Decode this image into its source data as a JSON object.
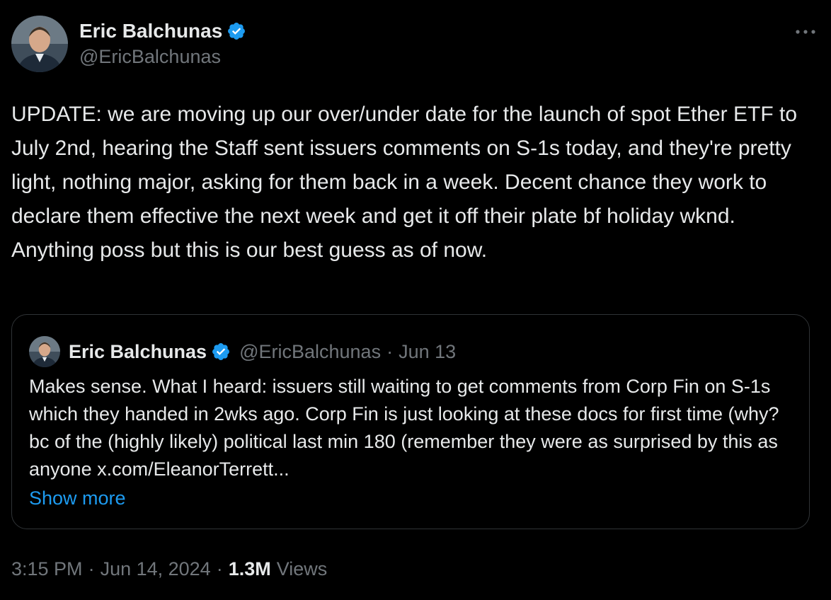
{
  "tweet": {
    "author": {
      "display_name": "Eric Balchunas",
      "handle": "@EricBalchunas",
      "verified": true
    },
    "body": "UPDATE: we are moving up our over/under date for the launch of spot Ether ETF to July 2nd, hearing the Staff sent issuers comments on S-1s today, and they're pretty light, nothing major, asking for them back in a week. Decent chance they work to declare them effective the next week and get it off their plate bf holiday wknd. Anything poss but this is our best guess as of now.",
    "more_icon": "ellipsis-icon"
  },
  "quote": {
    "display_name": "Eric Balchunas",
    "handle": "@EricBalchunas",
    "separator": "·",
    "date": "Jun 13",
    "body": "Makes sense. What I heard: issuers still waiting to get comments from Corp Fin on S-1s which they handed in 2wks ago. Corp Fin is just looking at these docs for first time (why? bc of the (highly likely) political last min 180 (remember they were as surprised by this as anyone x.com/EleanorTerrett...",
    "show_more": "Show more"
  },
  "meta": {
    "time": "3:15 PM",
    "sep1": "·",
    "date": "Jun 14, 2024",
    "sep2": "·",
    "views_count": "1.3M",
    "views_label": "Views"
  },
  "colors": {
    "background": "#000000",
    "text": "#e7e9ea",
    "secondary": "#71767b",
    "accent": "#1d9bf0",
    "border": "#2f3336"
  }
}
